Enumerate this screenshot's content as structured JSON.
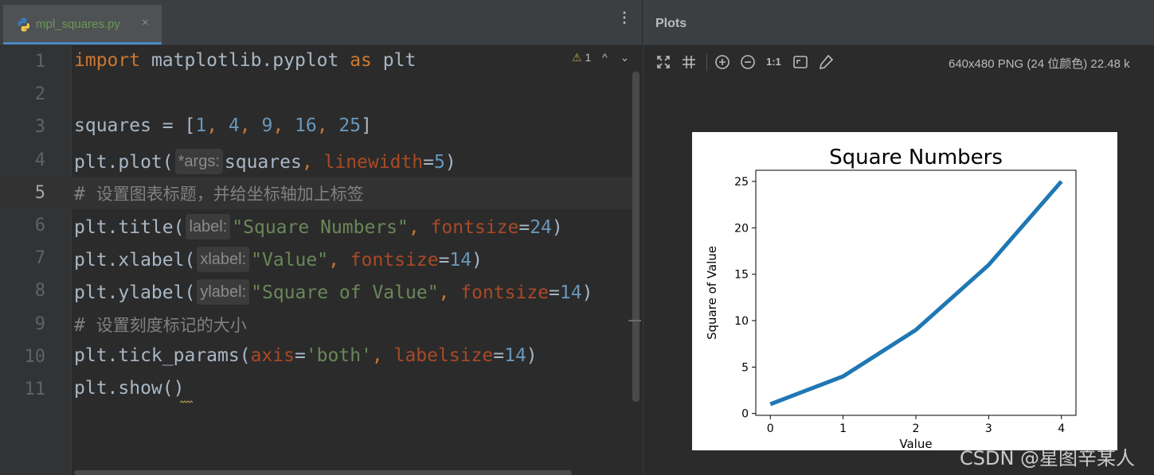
{
  "editor": {
    "tab": {
      "label": "mpl_squares.py",
      "close": "×",
      "icon": "python-file-icon"
    },
    "menu_glyph": "⋮",
    "inspection": {
      "icon": "warning-icon",
      "count": "1",
      "up": "^",
      "down": "⌄"
    },
    "lines": [
      {
        "n": "1",
        "tokens": [
          [
            "kw",
            "import"
          ],
          [
            "t",
            " matplotlib.pyplot "
          ],
          [
            "kw",
            "as"
          ],
          [
            "t",
            " plt"
          ]
        ]
      },
      {
        "n": "2",
        "tokens": []
      },
      {
        "n": "3",
        "tokens": [
          [
            "t",
            "squares = ["
          ],
          [
            "num",
            "1"
          ],
          [
            "kw",
            ", "
          ],
          [
            "num",
            "4"
          ],
          [
            "kw",
            ", "
          ],
          [
            "num",
            "9"
          ],
          [
            "kw",
            ", "
          ],
          [
            "num",
            "16"
          ],
          [
            "kw",
            ", "
          ],
          [
            "num",
            "25"
          ],
          [
            "t",
            "]"
          ]
        ]
      },
      {
        "n": "4",
        "tokens": [
          [
            "t",
            "plt.plot("
          ],
          [
            "hint",
            "*args:"
          ],
          [
            "t",
            "squares"
          ],
          [
            "kw",
            ", "
          ],
          [
            "param",
            "linewidth"
          ],
          [
            "t",
            "="
          ],
          [
            "num",
            "5"
          ],
          [
            "t",
            ")"
          ]
        ]
      },
      {
        "n": "5",
        "tokens": [
          [
            "cmt",
            "# "
          ],
          [
            "cmtcn",
            "设置图表标题，并给坐标轴加上标签"
          ]
        ]
      },
      {
        "n": "6",
        "tokens": [
          [
            "t",
            "plt.title("
          ],
          [
            "hint",
            "label:"
          ],
          [
            "str",
            "\"Square Numbers\""
          ],
          [
            "kw",
            ", "
          ],
          [
            "param",
            "fontsize"
          ],
          [
            "t",
            "="
          ],
          [
            "num",
            "24"
          ],
          [
            "t",
            ")"
          ]
        ]
      },
      {
        "n": "7",
        "tokens": [
          [
            "t",
            "plt.xlabel("
          ],
          [
            "hint",
            "xlabel:"
          ],
          [
            "str",
            "\"Value\""
          ],
          [
            "kw",
            ", "
          ],
          [
            "param",
            "fontsize"
          ],
          [
            "t",
            "="
          ],
          [
            "num",
            "14"
          ],
          [
            "t",
            ")"
          ]
        ]
      },
      {
        "n": "8",
        "tokens": [
          [
            "t",
            "plt.ylabel("
          ],
          [
            "hint",
            "ylabel:"
          ],
          [
            "str",
            "\"Square of Value\""
          ],
          [
            "kw",
            ", "
          ],
          [
            "param",
            "fontsize"
          ],
          [
            "t",
            "="
          ],
          [
            "num",
            "14"
          ],
          [
            "t",
            ")"
          ]
        ]
      },
      {
        "n": "9",
        "tokens": [
          [
            "cmt",
            "# "
          ],
          [
            "cmtcn",
            "设置刻度标记的大小"
          ]
        ]
      },
      {
        "n": "10",
        "tokens": [
          [
            "t",
            "plt.tick_params("
          ],
          [
            "param",
            "axis"
          ],
          [
            "t",
            "="
          ],
          [
            "str",
            "'both'"
          ],
          [
            "kw",
            ", "
          ],
          [
            "param",
            "labelsize"
          ],
          [
            "t",
            "="
          ],
          [
            "num",
            "14"
          ],
          [
            "t",
            ")"
          ]
        ]
      },
      {
        "n": "11",
        "tokens": [
          [
            "t",
            "plt.show()"
          ]
        ]
      }
    ],
    "current_line": 5
  },
  "plots": {
    "title": "Plots",
    "toolbar": [
      {
        "name": "fit-content-icon"
      },
      {
        "name": "actual-size-grid-icon"
      },
      {
        "name": "zoom-in-icon"
      },
      {
        "name": "zoom-out-icon"
      },
      {
        "name": "one-to-one-label",
        "text": "1:1"
      },
      {
        "name": "fit-window-icon"
      },
      {
        "name": "color-picker-icon"
      }
    ],
    "image_info": "640x480 PNG (24 位颜色) 22.48 k"
  },
  "chart_data": {
    "type": "line",
    "title": "Square Numbers",
    "xlabel": "Value",
    "ylabel": "Square of Value",
    "x": [
      0,
      1,
      2,
      3,
      4
    ],
    "series": [
      {
        "values": [
          1,
          4,
          9,
          16,
          25
        ],
        "color": "#1f77b4"
      }
    ],
    "xticks": [
      "0",
      "1",
      "2",
      "3",
      "4"
    ],
    "yticks": [
      "0",
      "5",
      "10",
      "15",
      "20",
      "25"
    ],
    "xlim": [
      -0.2,
      4.2
    ],
    "ylim": [
      -0.2,
      26.2
    ],
    "grid": false
  },
  "watermark": "CSDN @星图辛某人",
  "colors": {
    "keyword": "#cc7832",
    "number": "#6897bb",
    "string": "#6a8759",
    "comment": "#808080",
    "param": "#aa4926"
  }
}
